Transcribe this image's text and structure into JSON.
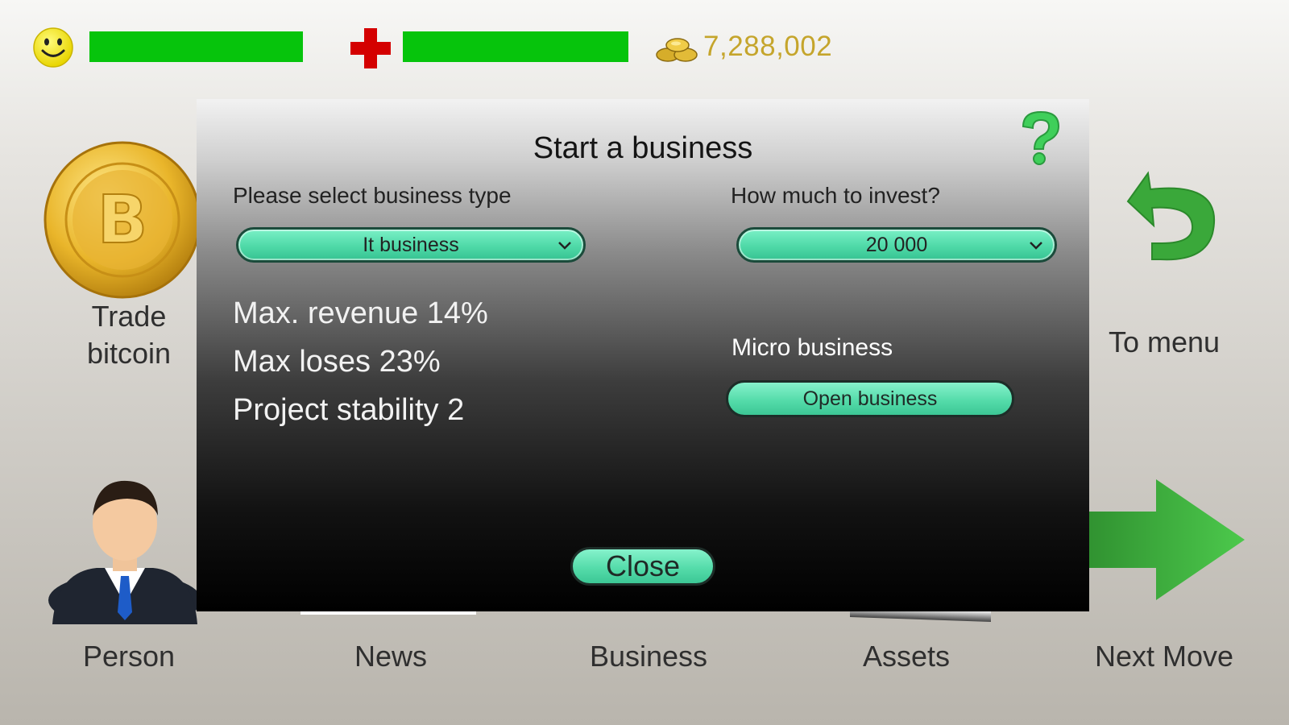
{
  "hud": {
    "mood_icon": "smiley-icon",
    "mood_level": 1.0,
    "health_icon": "red-cross-icon",
    "health_level": 1.0,
    "money_icon": "coins-icon",
    "money": "7,288,002",
    "bar_color": "#06c40c"
  },
  "tiles": {
    "trade_bitcoin": "Trade\nbitcoin",
    "to_menu": "To menu",
    "person": "Person",
    "news": "News",
    "business": "Business",
    "assets": "Assets",
    "next_move": "Next Move"
  },
  "modal": {
    "title": "Start a business",
    "help_icon": "question-mark-icon",
    "type_label": "Please select business type",
    "type_selected": "It business",
    "invest_label": "How much to invest?",
    "invest_selected": "20 000",
    "stats": {
      "revenue": "Max. revenue 14%",
      "loses": "Max loses 23%",
      "stability": "Project stability 2"
    },
    "category": "Micro business",
    "open_button": "Open business",
    "close_button": "Close"
  },
  "colors": {
    "accent_green": "#4fd9a8",
    "arrow_green": "#3aa83a",
    "money_gold": "#c5a52c"
  }
}
